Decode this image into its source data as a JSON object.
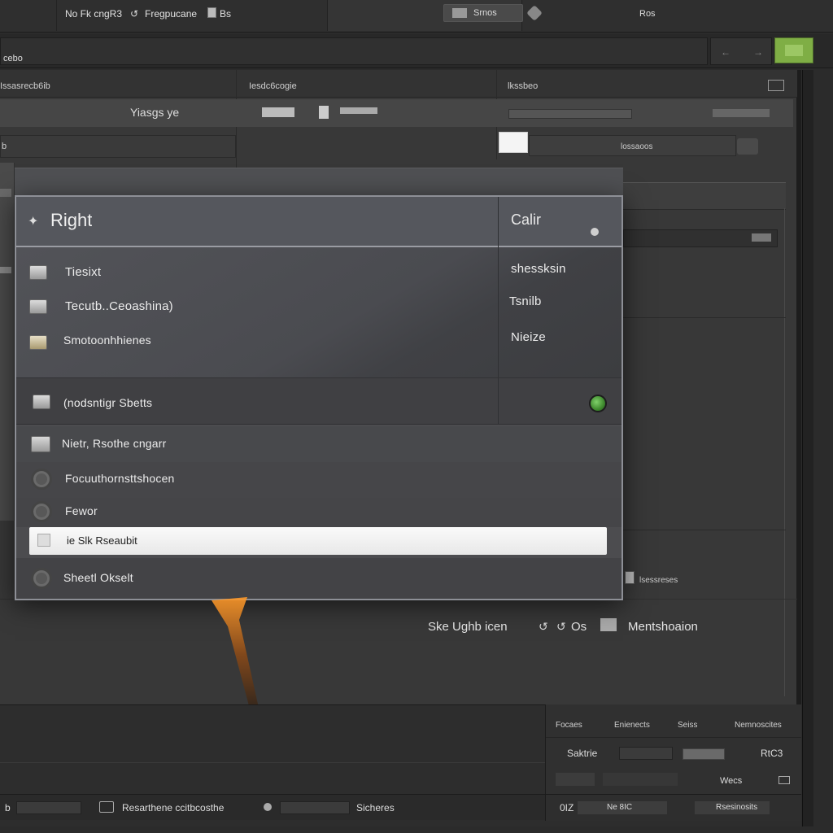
{
  "menubar": {
    "items": [
      "No Fk cngR3",
      "Fregpucane",
      "Bs"
    ],
    "search_label": "Srnos",
    "right_label": "Ros"
  },
  "toolbar": {
    "left_label": "cebo",
    "accent_color": "#8bc34a"
  },
  "panels": {
    "left_title": "Issasrecb6ib",
    "mid_title": "Iesdc6cogie",
    "right_title": "lkssbeo",
    "row2_text": "Yiasgs ye",
    "right_field_label": "lossaoos",
    "far_left_label": "b"
  },
  "dialog": {
    "title": "Right",
    "side_title": "Calir",
    "items": [
      {
        "label": "Tiesixt",
        "side": "shessksin"
      },
      {
        "label": "Tecutb..Ceoashina)",
        "side": "Tsnilb"
      },
      {
        "label": "Smotoonhhienes",
        "side": "Nieize"
      }
    ],
    "option_rows": [
      {
        "label": "(nodsntigr Sbetts"
      },
      {
        "label": "Nietr, Rsothe cngarr"
      },
      {
        "label": "Focuuthornsttshocen"
      },
      {
        "label": "Fewor"
      },
      {
        "label": "ie Slk Rseaubit"
      },
      {
        "label": "Sheetl Okselt"
      }
    ],
    "status_color": "#3f8a2e"
  },
  "editor": {
    "caption": "Ske Ughb icen",
    "caption2": "Os",
    "caption3": "Mentshoaion",
    "side_note": "lsessreses"
  },
  "bottom_panel": {
    "tabs": [
      "Focaes",
      "Enienects",
      "Seiss",
      "Nemnoscites"
    ],
    "label_left": "Saktrie",
    "label_right": "RtC3",
    "label_right2": "Wecs"
  },
  "statusbar": {
    "left_label": "b",
    "mid_label": "Resarthene ccitbcosthe",
    "right_label": "Sicheres",
    "far_label": "0IZ",
    "far_label2": "Ne 8IC",
    "end_label": "Rsesinosits"
  }
}
